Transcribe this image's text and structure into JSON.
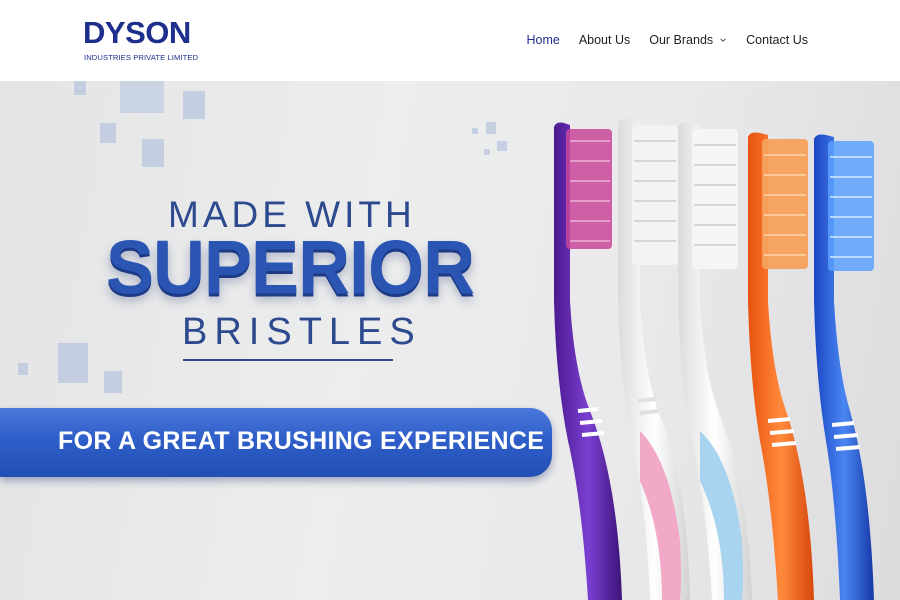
{
  "header": {
    "logo_word": "DYSON",
    "logo_subtitle": "INDUSTRIES PRIVATE LIMITED",
    "nav": [
      {
        "label": "Home",
        "active": true
      },
      {
        "label": "About Us",
        "active": false
      },
      {
        "label": "Our Brands",
        "active": false,
        "has_dropdown": true
      },
      {
        "label": "Contact Us",
        "active": false
      }
    ]
  },
  "hero": {
    "line1": "MADE WITH",
    "line2": "SUPERIOR",
    "line3": "BRISTLES",
    "banner": "FOR A GREAT BRUSHING EXPERIENCE"
  },
  "colors": {
    "brand_blue": "#1d2e8c",
    "logo_red": "#d81f26",
    "headline_blue": "#2b55b3",
    "banner_blue": "#2f5ec9"
  }
}
